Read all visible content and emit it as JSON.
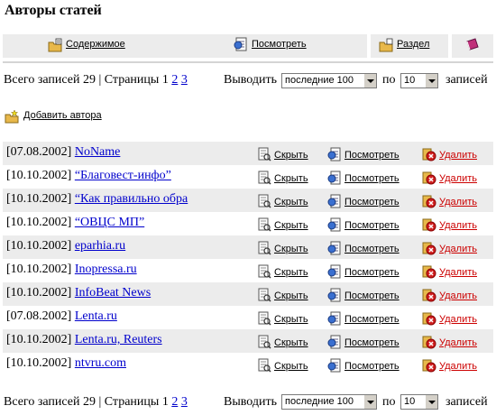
{
  "page": {
    "title": "Авторы статей"
  },
  "toolbar": {
    "contents_label": "Содержимое",
    "view_label": "Посмотреть",
    "section_label": "Раздел"
  },
  "pager": {
    "total_text": "Всего записей 29 | Страницы",
    "current_page": "1",
    "page_links": [
      "2",
      "3"
    ],
    "show_label": "Выводить",
    "show_value": "последние 100",
    "per_label": "по",
    "per_value": "10",
    "records_label": "записей"
  },
  "add_author_label": "Добавить автора",
  "actions": {
    "hide": "Скрыть",
    "view": "Посмотреть",
    "delete": "Удалить"
  },
  "authors": [
    {
      "date": "[07.08.2002]",
      "name": "NoName"
    },
    {
      "date": "[10.10.2002]",
      "name": "“Благовест-инфо”"
    },
    {
      "date": "[10.10.2002]",
      "name": "“Как правильно обра"
    },
    {
      "date": "[10.10.2002]",
      "name": "“ОВЦС МП”"
    },
    {
      "date": "[10.10.2002]",
      "name": "eparhia.ru"
    },
    {
      "date": "[10.10.2002]",
      "name": "Inopressa.ru"
    },
    {
      "date": "[10.10.2002]",
      "name": "InfoBeat News"
    },
    {
      "date": "[07.08.2002]",
      "name": "Lenta.ru"
    },
    {
      "date": "[10.10.2002]",
      "name": "Lenta.ru, Reuters"
    },
    {
      "date": "[10.10.2002]",
      "name": "ntvru.com"
    }
  ]
}
